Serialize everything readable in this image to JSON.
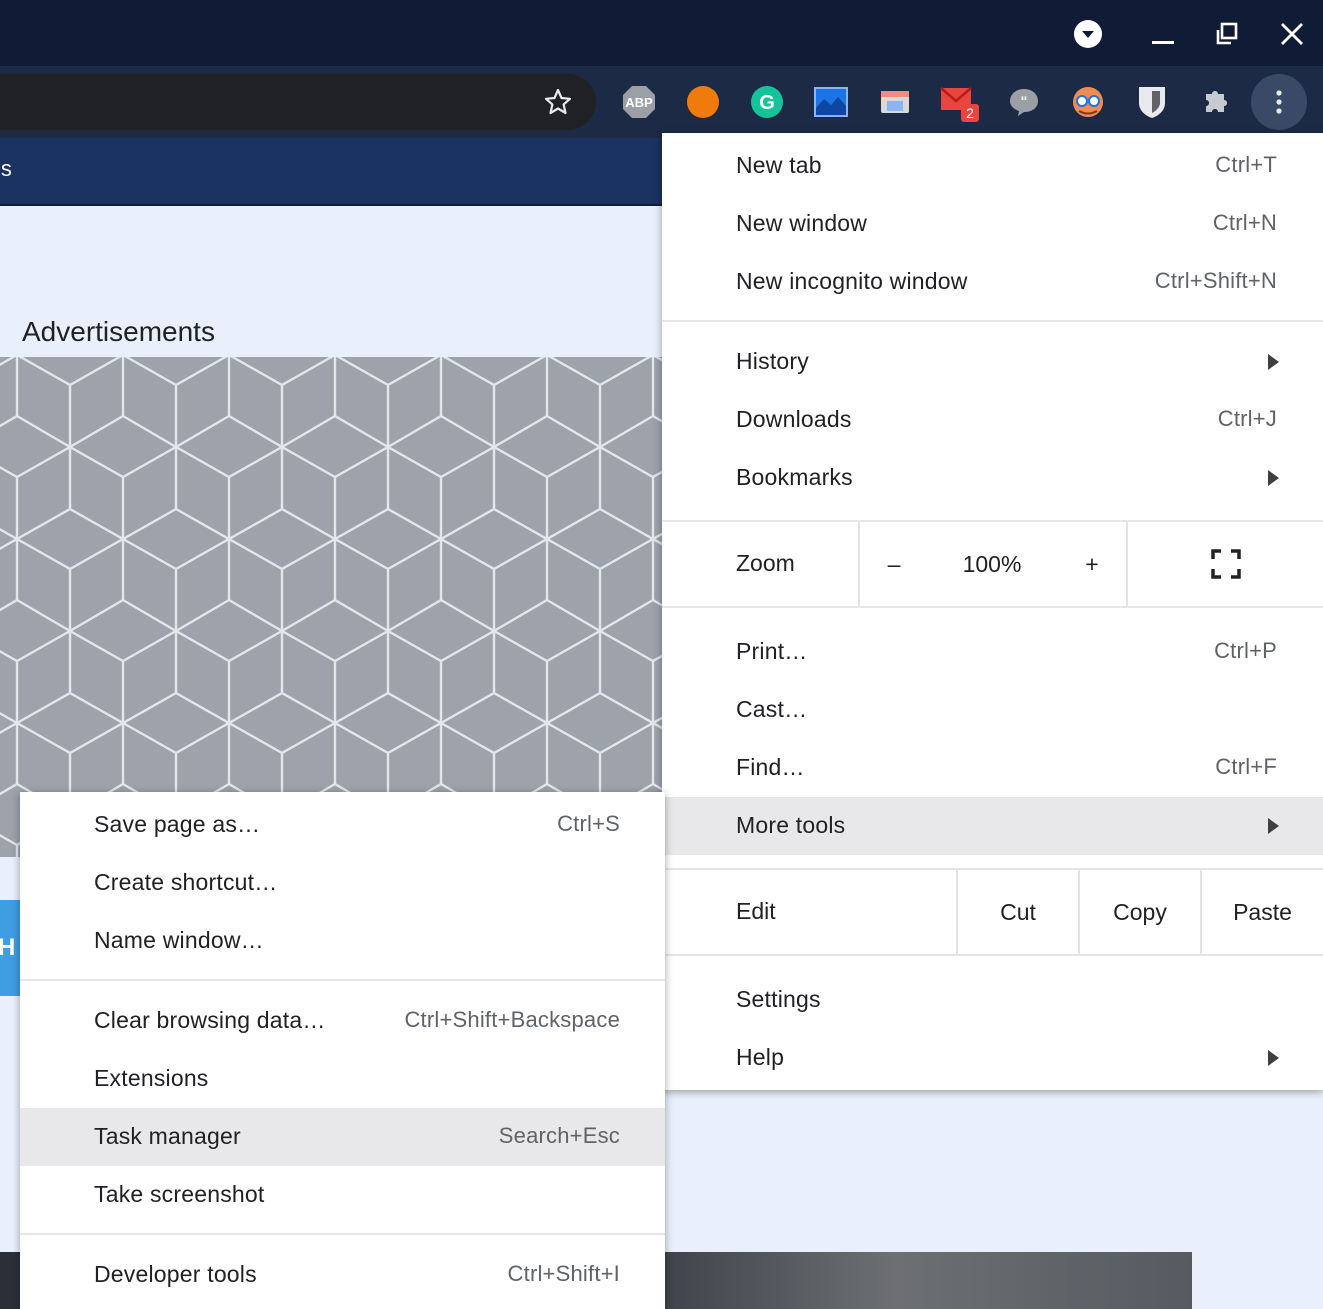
{
  "window": {
    "controls": [
      "tab-search",
      "minimize",
      "restore",
      "close"
    ]
  },
  "toolbar": {
    "extensions": [
      {
        "name": "abp-icon",
        "text": "ABP",
        "color": "#9aa0a6"
      },
      {
        "name": "orange-extension-icon",
        "color": "#f07b0c"
      },
      {
        "name": "grammarly-icon",
        "text": "G",
        "color": "#15c39a"
      },
      {
        "name": "screenshot-extension-icon",
        "color": "#1a73e8"
      },
      {
        "name": "window-extension-icon",
        "color": "#d9d9d9"
      },
      {
        "name": "mail-extension-icon",
        "color": "#e8453c",
        "badge": "2"
      },
      {
        "name": "quote-extension-icon",
        "color": "#9aa0a6"
      },
      {
        "name": "avatar-extension-icon",
        "color": "#f28b50"
      },
      {
        "name": "shield-extension-icon",
        "color": "#e8eaed"
      },
      {
        "name": "puzzle-icon",
        "color": "#c7cbd1"
      }
    ]
  },
  "page": {
    "nav_fragment": "js",
    "ads_label": "Advertisements",
    "side_tab_letter": "H"
  },
  "main_menu": {
    "new_tab": {
      "label": "New tab",
      "shortcut": "Ctrl+T"
    },
    "new_window": {
      "label": "New window",
      "shortcut": "Ctrl+N"
    },
    "new_incognito": {
      "label": "New incognito window",
      "shortcut": "Ctrl+Shift+N"
    },
    "history": {
      "label": "History"
    },
    "downloads": {
      "label": "Downloads",
      "shortcut": "Ctrl+J"
    },
    "bookmarks": {
      "label": "Bookmarks"
    },
    "zoom": {
      "label": "Zoom",
      "minus": "–",
      "value": "100%",
      "plus": "+"
    },
    "print": {
      "label": "Print…",
      "shortcut": "Ctrl+P"
    },
    "cast": {
      "label": "Cast…"
    },
    "find": {
      "label": "Find…",
      "shortcut": "Ctrl+F"
    },
    "more_tools": {
      "label": "More tools"
    },
    "edit": {
      "label": "Edit",
      "cut": "Cut",
      "copy": "Copy",
      "paste": "Paste"
    },
    "settings": {
      "label": "Settings"
    },
    "help": {
      "label": "Help"
    }
  },
  "more_tools_menu": {
    "save_page": {
      "label": "Save page as…",
      "shortcut": "Ctrl+S"
    },
    "create_shortcut": {
      "label": "Create shortcut…"
    },
    "name_window": {
      "label": "Name window…"
    },
    "clear_data": {
      "label": "Clear browsing data…",
      "shortcut": "Ctrl+Shift+Backspace"
    },
    "extensions": {
      "label": "Extensions"
    },
    "task_manager": {
      "label": "Task manager",
      "shortcut": "Search+Esc"
    },
    "take_screenshot": {
      "label": "Take screenshot"
    },
    "developer_tools": {
      "label": "Developer tools",
      "shortcut": "Ctrl+Shift+I"
    }
  },
  "colors": {
    "titlebar": "#101c35",
    "toolbar": "#1c2a45",
    "highlight": "#e8e8ea",
    "mail_badge": "#e8453c"
  }
}
